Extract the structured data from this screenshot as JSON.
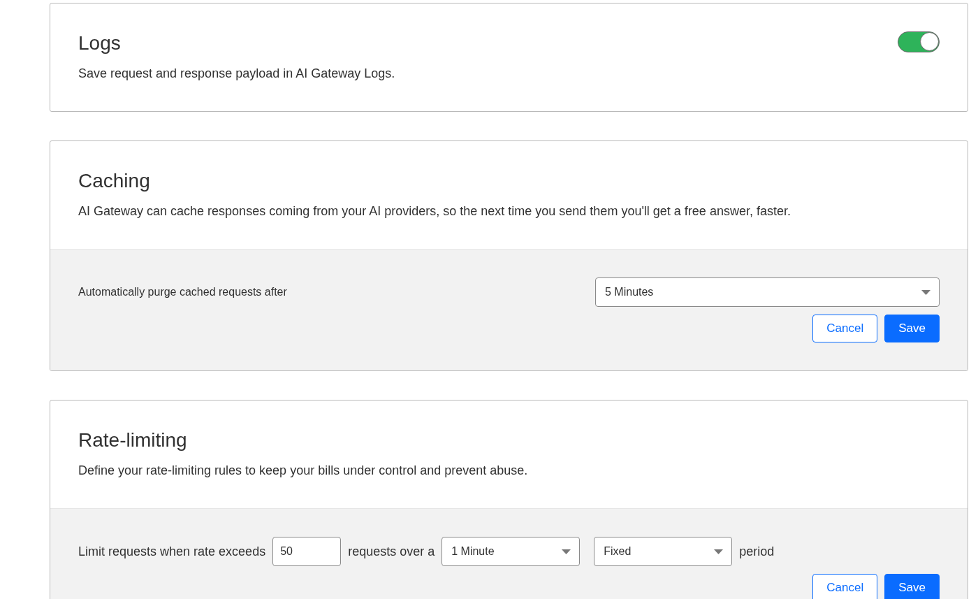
{
  "sections": [
    {
      "kind": "toggle",
      "title": "Logs",
      "description": "Save request and response payload in AI Gateway Logs.",
      "toggle": {
        "on": true
      }
    },
    {
      "kind": "settings",
      "title": "Caching",
      "description": "AI Gateway can cache responses coming from your AI providers, so the next time you send them you'll get a free answer, faster.",
      "row": [
        {
          "kind": "label",
          "text": "Automatically purge cached requests after"
        },
        {
          "kind": "select",
          "value": "5 Minutes"
        }
      ],
      "buttons": [
        "Cancel",
        "Save"
      ]
    },
    {
      "kind": "settings",
      "title": "Rate-limiting",
      "description": "Define your rate-limiting rules to keep your bills under control and prevent abuse.",
      "row": [
        {
          "kind": "text",
          "text": "Limit requests when rate exceeds"
        },
        {
          "kind": "input",
          "value": "50"
        },
        {
          "kind": "text",
          "text": "requests over a"
        },
        {
          "kind": "select",
          "value": "1 Minute"
        },
        {
          "kind": "select",
          "value": "Fixed"
        },
        {
          "kind": "text",
          "text": "period"
        }
      ],
      "buttons": [
        "Cancel",
        "Save"
      ]
    }
  ]
}
